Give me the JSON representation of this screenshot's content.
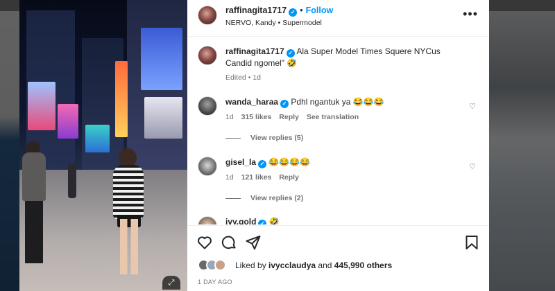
{
  "post": {
    "username": "raffinagita1717",
    "follow_label": "Follow",
    "subtitle": "NERVO, Kandy • Supermodel",
    "caption_user": "raffinagita1717",
    "caption_text": "Ala Super Model Times Squere NYCus Candid ngomel\" 🤣",
    "caption_meta": "Edited • 1d"
  },
  "comments": [
    {
      "user": "wanda_haraa",
      "text": "Pdhl ngantuk ya 😂😂😂",
      "time": "1d",
      "likes": "315 likes",
      "reply": "Reply",
      "translate": "See translation",
      "view_replies": "View replies (5)"
    },
    {
      "user": "gisel_la",
      "text": "😂😂😂😂",
      "time": "1d",
      "likes": "121 likes",
      "reply": "Reply",
      "view_replies": "View replies (2)"
    },
    {
      "user": "ivy.gold",
      "text": "🤣"
    }
  ],
  "likes": {
    "prefix": "Liked by ",
    "user": "ivycclaudya",
    "middle": " and ",
    "count": "445,990 others"
  },
  "time_ago": "1 DAY AGO",
  "icons": {
    "heart": "heart-icon",
    "comment": "comment-icon",
    "share": "share-icon",
    "save": "bookmark-icon",
    "more": "more-icon"
  },
  "colors": {
    "accent": "#0095f6",
    "text": "#262626",
    "muted": "#737373"
  }
}
